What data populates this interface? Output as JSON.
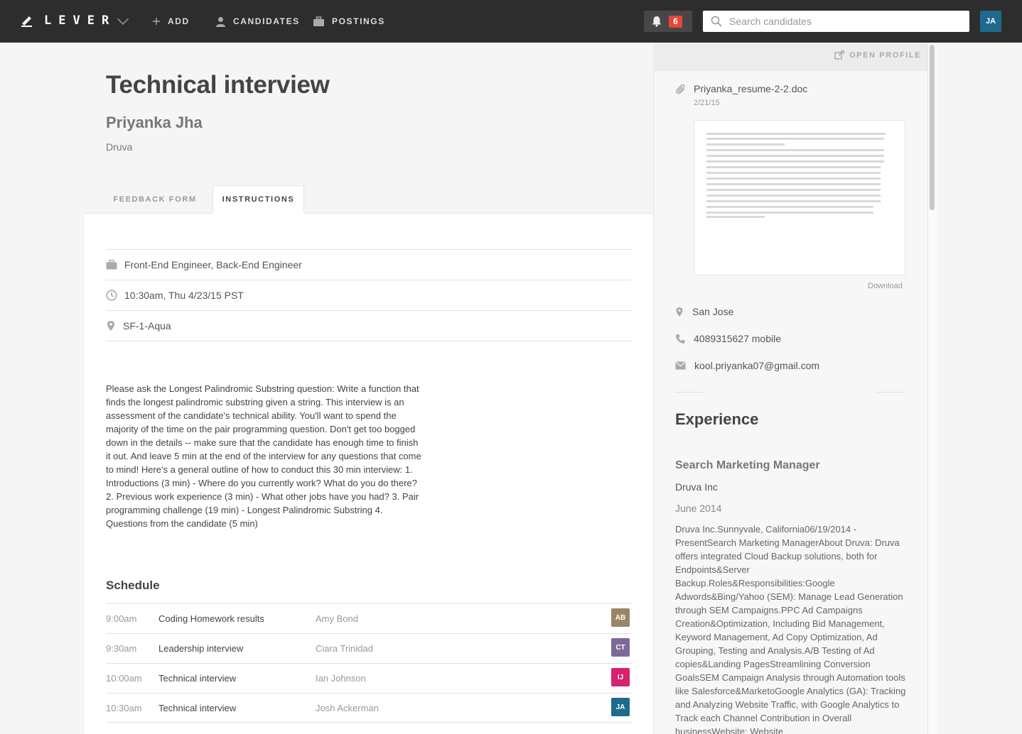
{
  "topbar": {
    "logo_text": "LEVER",
    "nav": [
      {
        "label": "ADD"
      },
      {
        "label": "CANDIDATES"
      },
      {
        "label": "POSTINGS"
      }
    ],
    "notification_count": "6",
    "search_placeholder": "Search candidates",
    "user_initials": "JA"
  },
  "header": {
    "title": "Technical interview",
    "candidate_name": "Priyanka Jha",
    "candidate_company": "Druva"
  },
  "tabs": [
    {
      "label": "FEEDBACK FORM",
      "active": false
    },
    {
      "label": "INSTRUCTIONS",
      "active": true
    }
  ],
  "details": {
    "postings": "Front-End Engineer, Back-End Engineer",
    "time": "10:30am, Thu 4/23/15 PST",
    "location": "SF-1-Aqua"
  },
  "instructions": "Please ask the Longest Palindromic Substring question: Write a function that finds the longest palindromic substring given a string. This interview is an assessment of the candidate's technical ability. You'll want to spend the majority of the time on the pair programming question. Don't get too bogged down in the details -- make sure that the candidate has enough time to finish it out. And leave 5 min at the end of the interview for any questions that come to mind! Here's a general outline of how to conduct this 30 min interview: 1. Introductions (3 min) - Where do you currently work? What do you do there? 2. Previous work experience (3 min) - What other jobs have you had? 3. Pair programming challenge (19 min) - Longest Palindromic Substring 4. Questions from the candidate (5 min)",
  "schedule": {
    "title": "Schedule",
    "rows": [
      {
        "time": "9:00am",
        "title": "Coding Homework results",
        "person": "Amy Bond",
        "initials": "AB",
        "color": "#9b8567"
      },
      {
        "time": "9:30am",
        "title": "Leadership interview",
        "person": "Ciara Trinidad",
        "initials": "CT",
        "color": "#7c6a98"
      },
      {
        "time": "10:00am",
        "title": "Technical interview",
        "person": "Ian Johnson",
        "initials": "IJ",
        "color": "#d6226f"
      },
      {
        "time": "10:30am",
        "title": "Technical interview",
        "person": "Josh Ackerman",
        "initials": "JA",
        "color": "#1e6a8e"
      }
    ]
  },
  "sidebar": {
    "open_profile": "OPEN PROFILE",
    "resume_name": "Priyanka_resume-2-2.doc",
    "resume_date": "2/21/15",
    "download": "Download",
    "location": "San Jose",
    "phone": "4089315627 mobile",
    "email": "kool.priyanka07@gmail.com",
    "experience_heading": "Experience",
    "experience": {
      "title": "Search Marketing Manager",
      "company": "Druva Inc",
      "date": "June 2014",
      "description": "Druva Inc.Sunnyvale, California06/19/2014 - PresentSearch Marketing ManagerAbout Druva: Druva offers integrated Cloud Backup solutions, both for Endpoints&Server Backup.Roles&Responsibilities:Google Adwords&Bing/Yahoo (SEM): Manage Lead Generation through SEM Campaigns.PPC Ad Campaigns Creation&Optimization, Including Bid Management, Keyword Management, Ad Copy Optimization,  Ad Grouping, Testing and Analysis.A/B Testing of Ad copies&Landing PagesStreamlining Conversion GoalsSEM Campaign Analysis through Automation tools like Salesforce&MarketoGoogle Analytics (GA): Tracking and Analyzing Website Traffic, with Google Analytics to Track each Channel Contribution in Overall businessWebsite: Website"
    }
  },
  "colors": {
    "topbar": "#2d2d2d",
    "notification_badge": "#e8453c",
    "user_avatar": "#1e6a8e"
  }
}
